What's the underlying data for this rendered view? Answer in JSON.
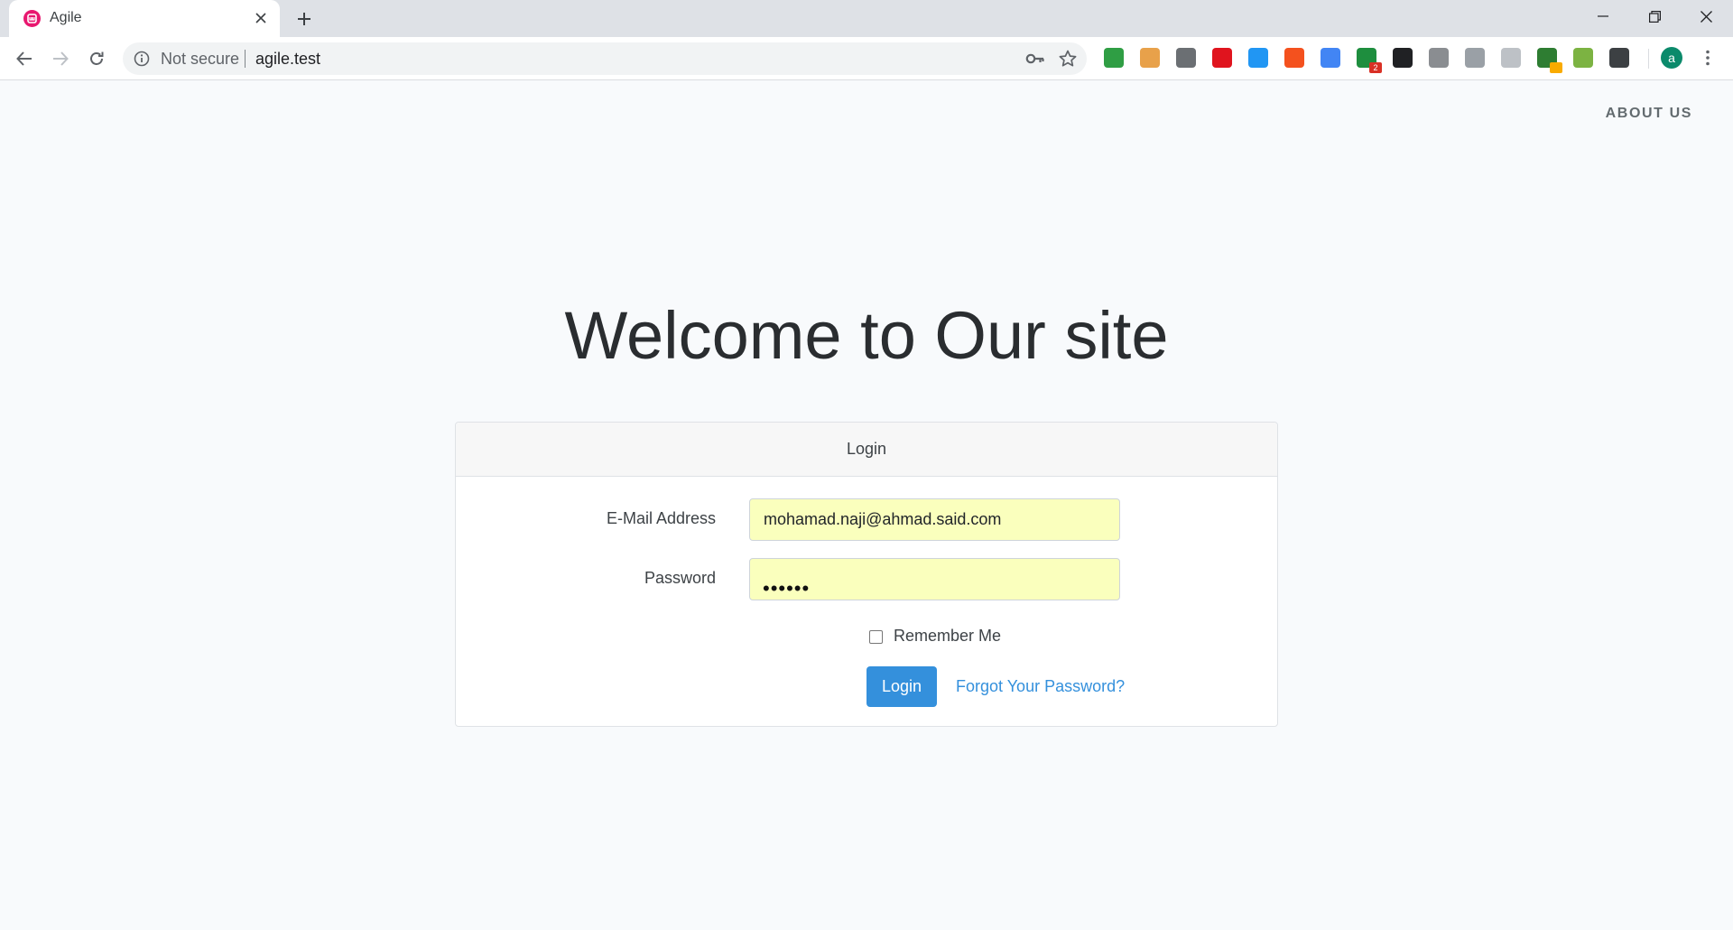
{
  "browser": {
    "tab_title": "Agile",
    "security_text": "Not secure",
    "url": "agile.test",
    "profile_initial": "a",
    "extensions": [
      {
        "name": "globe-extension-icon",
        "color": "#2f9e44"
      },
      {
        "name": "ninja-extension-icon",
        "color": "#e8a14a"
      },
      {
        "name": "puzzle-extension-icon",
        "color": "#6b6f73"
      },
      {
        "name": "opera-extension-icon",
        "color": "#e0141e"
      },
      {
        "name": "window-extension-icon",
        "color": "#2196f3"
      },
      {
        "name": "hand-extension-icon",
        "color": "#f4511e"
      },
      {
        "name": "translate-extension-icon",
        "color": "#4285f4"
      },
      {
        "name": "green-circle-extension-icon",
        "color": "#1e8e3e",
        "badge": "2",
        "badge_color": "#d93025"
      },
      {
        "name": "qr-code-extension-icon",
        "color": "#202124"
      },
      {
        "name": "v-extension-icon",
        "color": "#8a8d91"
      },
      {
        "name": "bolt-extension-icon",
        "color": "#9aa0a6"
      },
      {
        "name": "drive-extension-icon",
        "color": "#bdc1c6"
      },
      {
        "name": "earth-extension-icon",
        "color": "#2e7d32",
        "badge": " ",
        "badge_color": "#f9ab00"
      },
      {
        "name": "branch-extension-icon",
        "color": "#7cb342"
      },
      {
        "name": "stack-extension-icon",
        "color": "#3c4043"
      }
    ]
  },
  "nav": {
    "about_label": "ABOUT US"
  },
  "hero": {
    "title": "Welcome to Our site"
  },
  "login_card": {
    "header": "Login",
    "email_label": "E-Mail Address",
    "email_value": "mohamad.naji@ahmad.said.com",
    "password_label": "Password",
    "password_masked": "••••••",
    "remember_label": "Remember Me",
    "remember_checked": false,
    "submit_label": "Login",
    "forgot_label": "Forgot Your Password?"
  },
  "colors": {
    "primary": "#3490dc",
    "autofill": "#faffbd",
    "background": "#f8fafc"
  }
}
